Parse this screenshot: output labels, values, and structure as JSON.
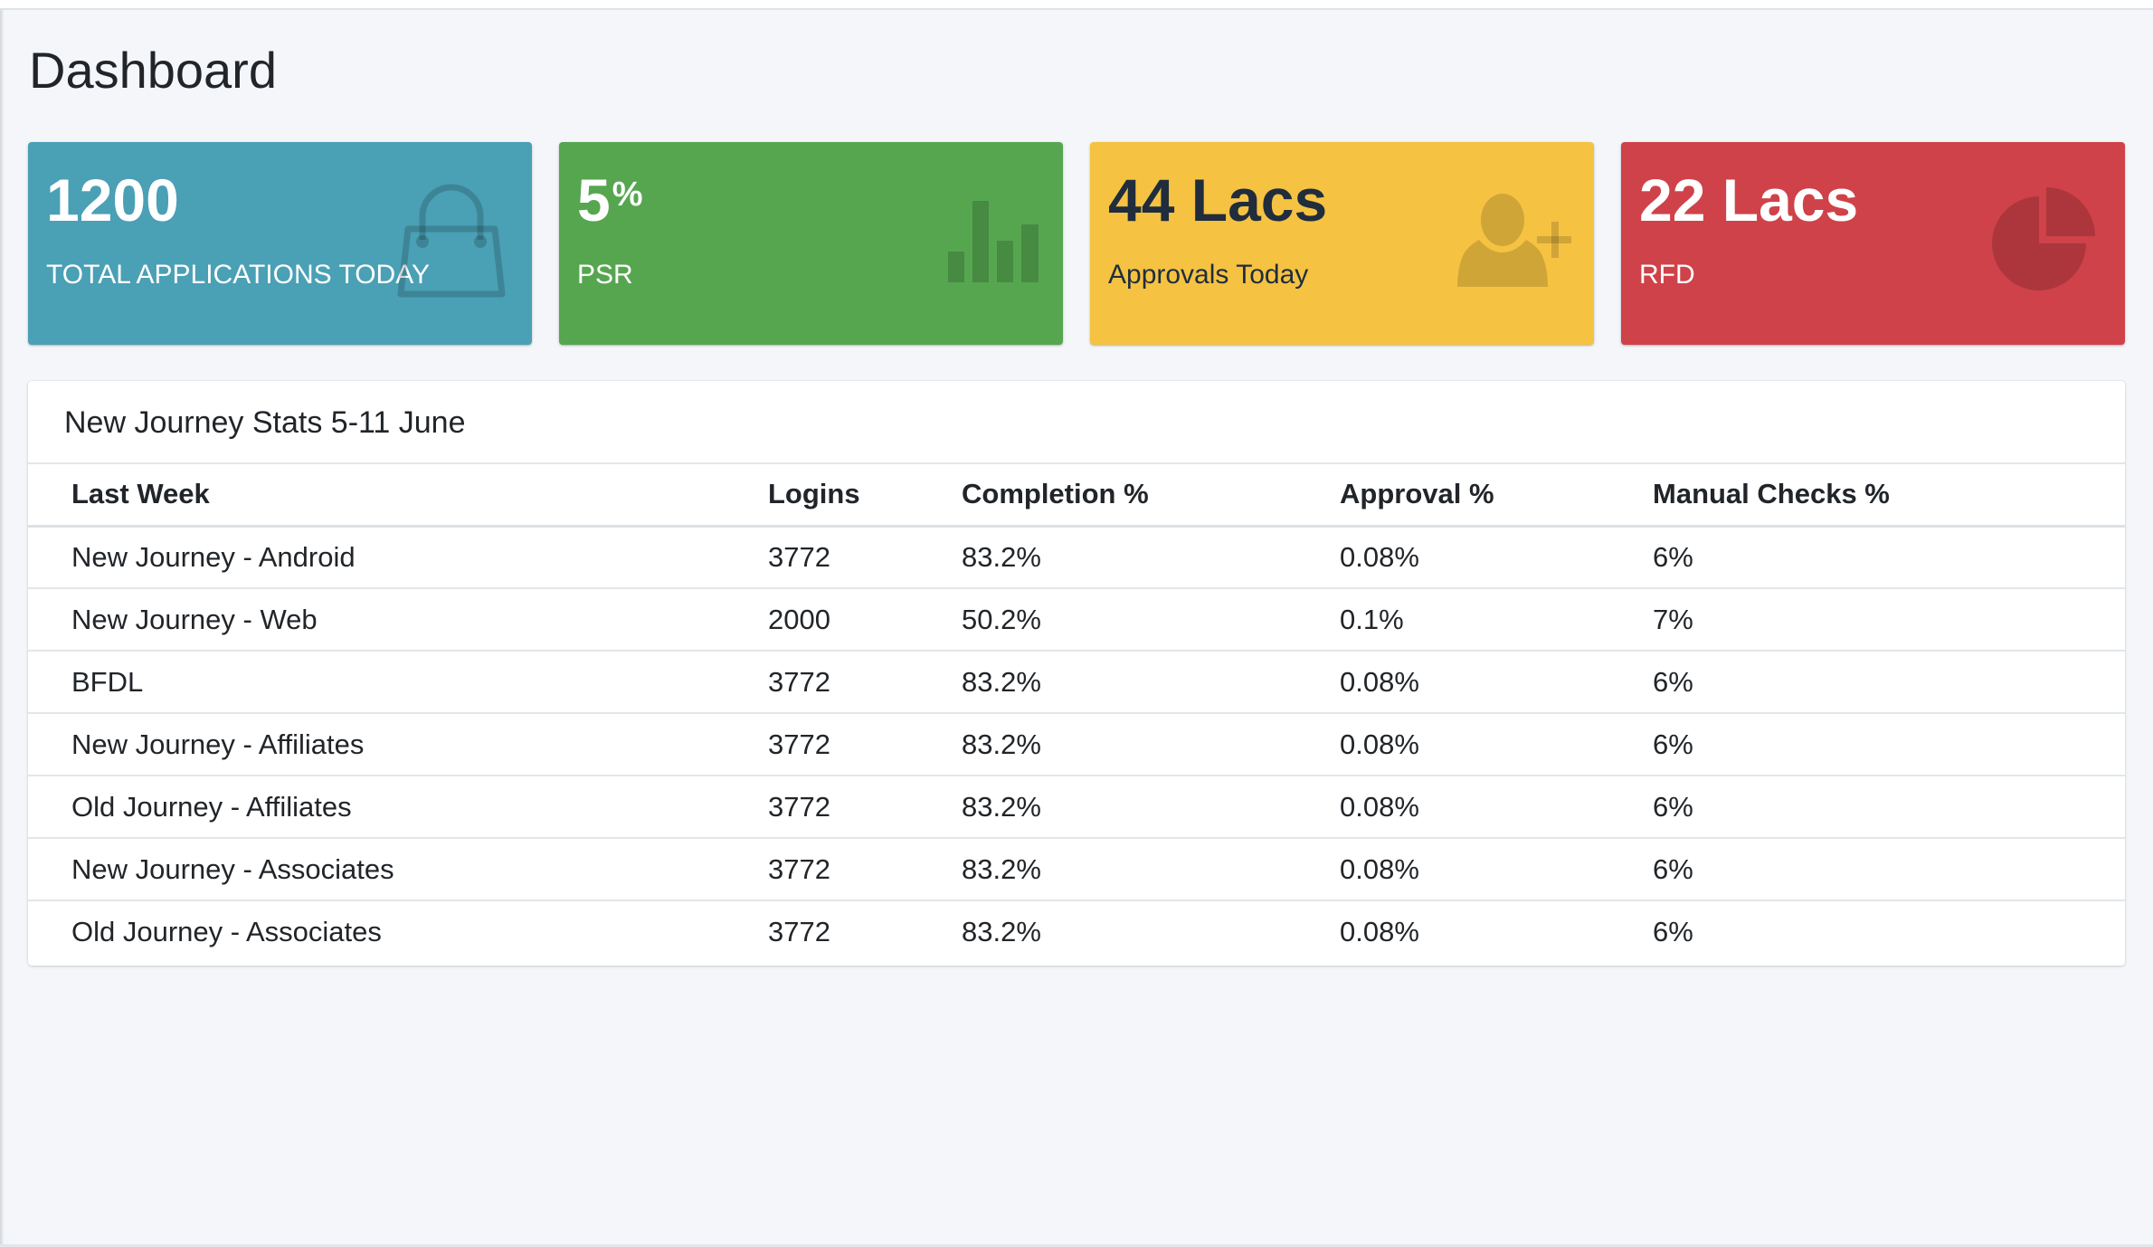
{
  "page": {
    "title": "Dashboard"
  },
  "stats": [
    {
      "value": "1200",
      "suffix": "",
      "label": "TOTAL APPLICATIONS TODAY",
      "color": "#4aa0b5",
      "icon": "shopping-bag-icon"
    },
    {
      "value": "5",
      "suffix": "%",
      "label": "PSR",
      "color": "#56a650",
      "icon": "bar-chart-icon"
    },
    {
      "value": "44 Lacs",
      "suffix": "",
      "label": "Approvals Today",
      "color": "#f5c242",
      "icon": "user-plus-icon"
    },
    {
      "value": "22 Lacs",
      "suffix": "",
      "label": "RFD",
      "color": "#cf4249",
      "icon": "pie-chart-icon"
    }
  ],
  "journey_table": {
    "title": "New Journey Stats 5-11 June",
    "columns": [
      "Last Week",
      "Logins",
      "Completion %",
      "Approval %",
      "Manual Checks %"
    ],
    "rows": [
      [
        "New Journey - Android",
        "3772",
        "83.2%",
        "0.08%",
        "6%"
      ],
      [
        "New Journey - Web",
        "2000",
        "50.2%",
        "0.1%",
        "7%"
      ],
      [
        "BFDL",
        "3772",
        "83.2%",
        "0.08%",
        "6%"
      ],
      [
        "New Journey - Affiliates",
        "3772",
        "83.2%",
        "0.08%",
        "6%"
      ],
      [
        "Old Journey - Affiliates",
        "3772",
        "83.2%",
        "0.08%",
        "6%"
      ],
      [
        "New Journey - Associates",
        "3772",
        "83.2%",
        "0.08%",
        "6%"
      ],
      [
        "Old Journey - Associates",
        "3772",
        "83.2%",
        "0.08%",
        "6%"
      ]
    ]
  }
}
